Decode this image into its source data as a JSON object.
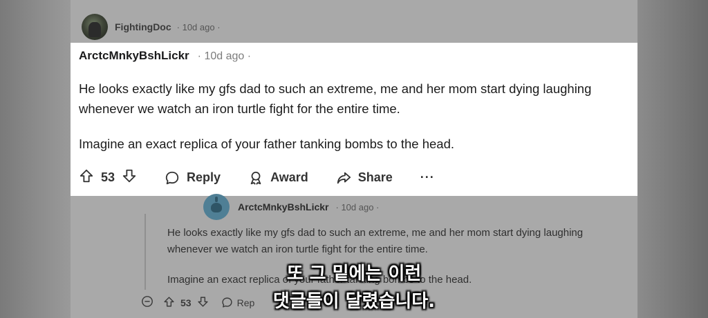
{
  "parent": {
    "username": "FightingDoc",
    "meta": "· 10d ago ·"
  },
  "highlighted_comment": {
    "username": "ArctcMnkyBshLickr",
    "meta": "· 10d ago ·",
    "paragraphs": [
      "He looks exactly like my gfs dad to such an extreme, me and her mom start dying laughing whenever we watch an iron turtle fight for the entire time.",
      "Imagine an exact replica of your father tanking bombs to the head."
    ],
    "votes": "53",
    "actions": {
      "reply": "Reply",
      "award": "Award",
      "share": "Share",
      "more": "···"
    }
  },
  "reply_comment": {
    "username": "ArctcMnkyBshLickr",
    "meta": "· 10d ago ·",
    "paragraphs": [
      "He looks exactly like my gfs dad to such an extreme, me and her mom start dying laughing whenever we watch an iron turtle fight for the entire time.",
      "Imagine an exact replica of your father tanking bombs to the head."
    ],
    "votes": "53",
    "reply_label": "Rep",
    "more": "···"
  },
  "subtitle": {
    "line1": "또 그 밑에는 이런",
    "line2": "댓글들이 달렸습니다."
  }
}
